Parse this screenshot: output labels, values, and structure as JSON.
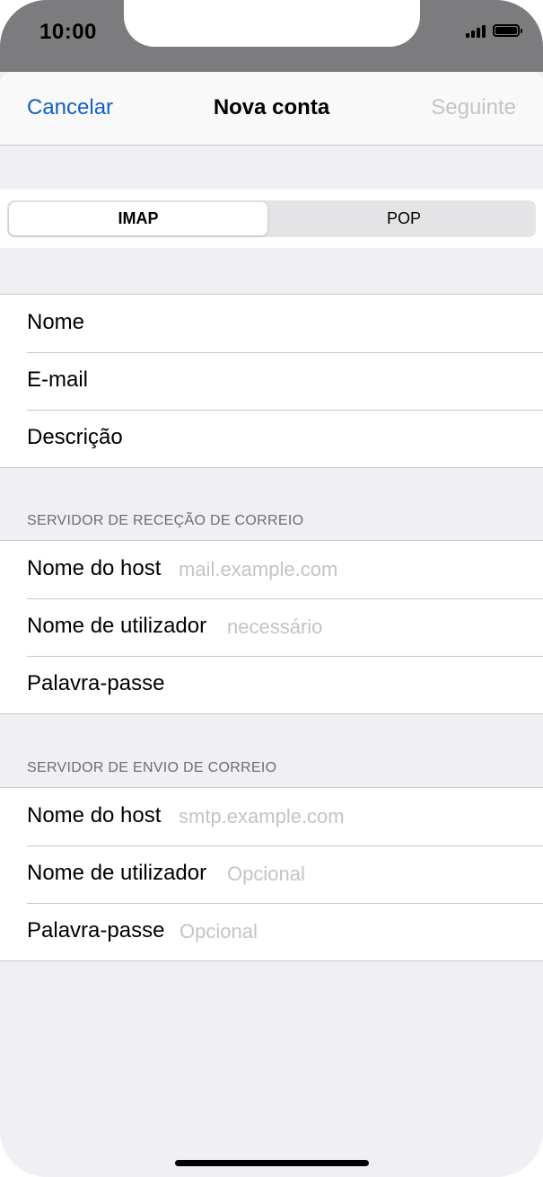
{
  "status_bar": {
    "time": "10:00",
    "icons": [
      "signal-icon",
      "battery-icon"
    ]
  },
  "navbar": {
    "cancel": "Cancelar",
    "title": "Nova conta",
    "next": "Seguinte"
  },
  "segment": {
    "options": [
      "IMAP",
      "POP"
    ],
    "selected": "IMAP"
  },
  "account": {
    "rows": [
      {
        "label": "Nome"
      },
      {
        "label": "E-mail"
      },
      {
        "label": "Descrição"
      }
    ]
  },
  "incoming": {
    "header": "SERVIDOR DE RECEÇÃO DE CORREIO",
    "rows": [
      {
        "label": "Nome do host",
        "placeholder": "mail.example.com"
      },
      {
        "label": "Nome de utilizador",
        "placeholder": "necessário"
      },
      {
        "label": "Palavra-passe",
        "placeholder": ""
      }
    ]
  },
  "outgoing": {
    "header": "SERVIDOR DE ENVIO DE CORREIO",
    "rows": [
      {
        "label": "Nome do host",
        "placeholder": "smtp.example.com"
      },
      {
        "label": "Nome de utilizador",
        "placeholder": "Opcional"
      },
      {
        "label": "Palavra-passe",
        "placeholder": "Opcional"
      }
    ]
  },
  "colors": {
    "accent": "#1560bd",
    "disabled": "#c4c4c6",
    "background": "#efeff4",
    "separator": "#c8c7cc"
  }
}
